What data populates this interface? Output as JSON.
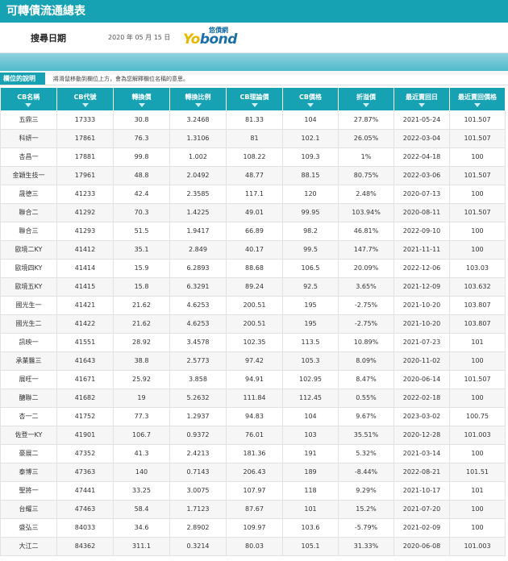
{
  "page": {
    "title": "可轉債流通總表"
  },
  "query": {
    "label": "搜尋日期",
    "date": "2020 年 05 月 15 日"
  },
  "logo": {
    "cn": "悠債網",
    "yo": "Yo",
    "bond": "bond"
  },
  "note": {
    "tag": "欄位的說明",
    "text": "將滑鼠移動到欄位上方，會為您解釋欄位名稱的意思。"
  },
  "table": {
    "columns": [
      "CB名稱",
      "CB代號",
      "轉換價",
      "轉換比例",
      "CB理論價",
      "CB價格",
      "折溢價",
      "最近賣回日",
      "最近賣回價格"
    ],
    "rows": [
      [
        "五鼎三",
        "17333",
        "30.8",
        "3.2468",
        "81.33",
        "104",
        "27.87%",
        "2021-05-24",
        "101.507"
      ],
      [
        "科妍一",
        "17861",
        "76.3",
        "1.3106",
        "81",
        "102.1",
        "26.05%",
        "2022-03-04",
        "101.507"
      ],
      [
        "杏昌一",
        "17881",
        "99.8",
        "1.002",
        "108.22",
        "109.3",
        "1%",
        "2022-04-18",
        "100"
      ],
      [
        "金穎生技一",
        "17961",
        "48.8",
        "2.0492",
        "48.77",
        "88.15",
        "80.75%",
        "2022-03-06",
        "101.507"
      ],
      [
        "晟德三",
        "41233",
        "42.4",
        "2.3585",
        "117.1",
        "120",
        "2.48%",
        "2020-07-13",
        "100"
      ],
      [
        "聯合二",
        "41292",
        "70.3",
        "1.4225",
        "49.01",
        "99.95",
        "103.94%",
        "2020-08-11",
        "101.507"
      ],
      [
        "聯合三",
        "41293",
        "51.5",
        "1.9417",
        "66.89",
        "98.2",
        "46.81%",
        "2022-09-10",
        "100"
      ],
      [
        "歐境二KY",
        "41412",
        "35.1",
        "2.849",
        "40.17",
        "99.5",
        "147.7%",
        "2021-11-11",
        "100"
      ],
      [
        "歐境四KY",
        "41414",
        "15.9",
        "6.2893",
        "88.68",
        "106.5",
        "20.09%",
        "2022-12-06",
        "103.03"
      ],
      [
        "歐境五KY",
        "41415",
        "15.8",
        "6.3291",
        "89.24",
        "92.5",
        "3.65%",
        "2021-12-09",
        "103.632"
      ],
      [
        "國光生一",
        "41421",
        "21.62",
        "4.6253",
        "200.51",
        "195",
        "-2.75%",
        "2021-10-20",
        "103.807"
      ],
      [
        "國光生二",
        "41422",
        "21.62",
        "4.6253",
        "200.51",
        "195",
        "-2.75%",
        "2021-10-20",
        "103.807"
      ],
      [
        "訊映一",
        "41551",
        "28.92",
        "3.4578",
        "102.35",
        "113.5",
        "10.89%",
        "2021-07-23",
        "101"
      ],
      [
        "承業醫三",
        "41643",
        "38.8",
        "2.5773",
        "97.42",
        "105.3",
        "8.09%",
        "2020-11-02",
        "100"
      ],
      [
        "展旺一",
        "41671",
        "25.92",
        "3.858",
        "94.91",
        "102.95",
        "8.47%",
        "2020-06-14",
        "101.507"
      ],
      [
        "醣聯二",
        "41682",
        "19",
        "5.2632",
        "111.84",
        "112.45",
        "0.55%",
        "2022-02-18",
        "100"
      ],
      [
        "杏一二",
        "41752",
        "77.3",
        "1.2937",
        "94.83",
        "104",
        "9.67%",
        "2023-03-02",
        "100.75"
      ],
      [
        "佐登一KY",
        "41901",
        "106.7",
        "0.9372",
        "76.01",
        "103",
        "35.51%",
        "2020-12-28",
        "101.003"
      ],
      [
        "豪展二",
        "47352",
        "41.3",
        "2.4213",
        "181.36",
        "191",
        "5.32%",
        "2021-03-14",
        "100"
      ],
      [
        "泰博三",
        "47363",
        "140",
        "0.7143",
        "206.43",
        "189",
        "-8.44%",
        "2022-08-21",
        "101.51"
      ],
      [
        "聖將一",
        "47441",
        "33.25",
        "3.0075",
        "107.97",
        "118",
        "9.29%",
        "2021-10-17",
        "101"
      ],
      [
        "台耀三",
        "47463",
        "58.4",
        "1.7123",
        "87.67",
        "101",
        "15.2%",
        "2021-07-20",
        "100"
      ],
      [
        "盛弘三",
        "84033",
        "34.6",
        "2.8902",
        "109.97",
        "103.6",
        "-5.79%",
        "2021-02-09",
        "100"
      ],
      [
        "大江二",
        "84362",
        "311.1",
        "0.3214",
        "80.03",
        "105.1",
        "31.33%",
        "2020-06-08",
        "101.003"
      ]
    ]
  }
}
